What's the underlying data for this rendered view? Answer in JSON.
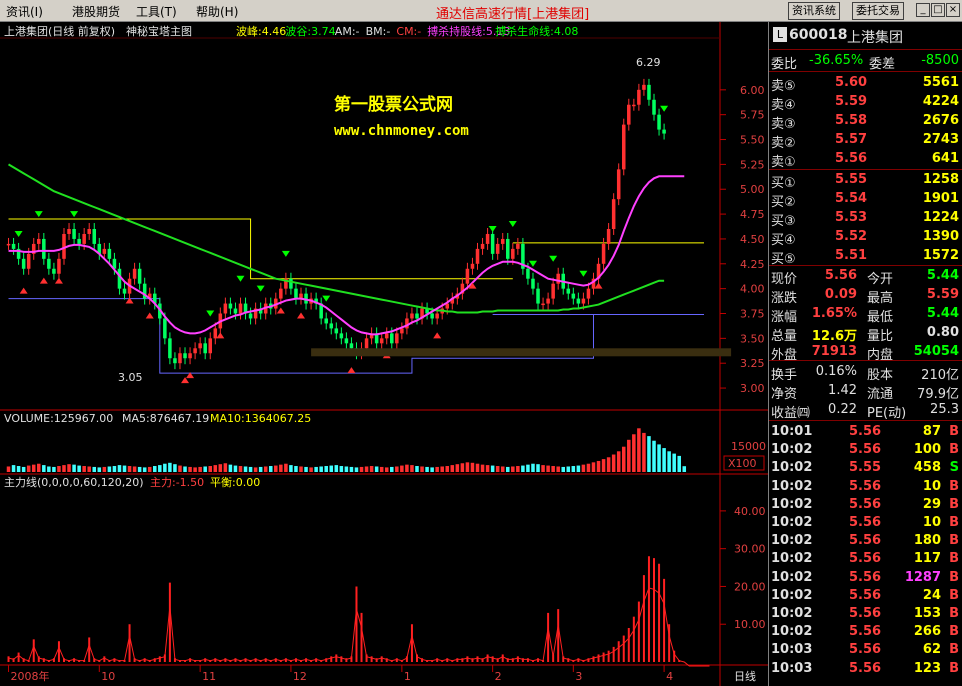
{
  "menu": {
    "items": [
      "资讯(I)",
      "港股期货",
      "工具(T)",
      "帮助(H)"
    ],
    "app_title": "通达信高速行情[上港集团]",
    "buttons": [
      "资讯系统",
      "委托交易"
    ],
    "window_buttons": [
      "_",
      "□",
      "×"
    ]
  },
  "chart_header": {
    "name": "上港集团(日线 前复权)",
    "indicator": "神秘宝塔主图",
    "boxes": [
      {
        "label": "波峰:4.46",
        "color": "#ffff00"
      },
      {
        "label": "波谷:3.74",
        "color": "#00ff00"
      },
      {
        "label": "AM:-",
        "color": "#e0e0e0"
      },
      {
        "label": "BM:-",
        "color": "#e0e0e0"
      },
      {
        "label": "CM:-",
        "color": "#ff4040"
      },
      {
        "label": "搏杀持股线:5.13",
        "color": "#ff40ff"
      },
      {
        "label": "搏杀生命线:4.08",
        "color": "#00ff00"
      }
    ]
  },
  "watermark": {
    "line1": "第一股票公式网",
    "line2": "www.chnmoney.com"
  },
  "annotations": {
    "high": "6.29",
    "low": "3.05"
  },
  "volume_header": {
    "label": "VOLUME:125967.00",
    "ma5": "MA5:876467.19",
    "ma10": "MA10:1364067.25"
  },
  "force_header": {
    "label": "主力线(0,0,0,0,60,120,20)",
    "main": "主力:-1.50",
    "balance": "平衡:0.00"
  },
  "volume_axis": {
    "tick": "15000",
    "unit": "X100"
  },
  "force_axis": {
    "ticks": [
      "40.00",
      "30.00",
      "20.00",
      "10.00"
    ]
  },
  "xaxis": {
    "labels": [
      "2008年",
      "10",
      "11",
      "12",
      "1",
      "2",
      "3",
      "4"
    ],
    "period": "日线"
  },
  "chart_data": {
    "type": "line",
    "title": "上港集团(日线 前复权)",
    "ylim": [
      2.9,
      6.3
    ],
    "yticks": [
      "6.00",
      "5.75",
      "5.50",
      "5.25",
      "5.00",
      "4.75",
      "4.50",
      "4.25",
      "4.00",
      "3.75",
      "3.50",
      "3.25",
      "3.00"
    ],
    "x": [
      1,
      2,
      3,
      4,
      5,
      6,
      7,
      8,
      9,
      10,
      11,
      12,
      13,
      14,
      15,
      16,
      17,
      18,
      19,
      20,
      21,
      22,
      23,
      24,
      25,
      26,
      27,
      28,
      29,
      30,
      31,
      32,
      33,
      34,
      35,
      36,
      37,
      38,
      39,
      40,
      41,
      42,
      43,
      44,
      45,
      46,
      47,
      48,
      49,
      50,
      51,
      52,
      53,
      54,
      55,
      56,
      57,
      58,
      59,
      60,
      61,
      62,
      63,
      64,
      65,
      66,
      67,
      68,
      69,
      70,
      71,
      72,
      73,
      74,
      75,
      76,
      77,
      78,
      79,
      80,
      81,
      82,
      83,
      84,
      85,
      86,
      87,
      88,
      89,
      90,
      91,
      92,
      93,
      94,
      95,
      96,
      97,
      98,
      99,
      100,
      101,
      102,
      103,
      104,
      105,
      106,
      107,
      108,
      109,
      110,
      111,
      112,
      113,
      114,
      115,
      116,
      117,
      118,
      119,
      120,
      121,
      122,
      123,
      124,
      125,
      126,
      127,
      128,
      129,
      130,
      131,
      132,
      133,
      134,
      135,
      136,
      137,
      138,
      139,
      140
    ],
    "series": [
      {
        "name": "close",
        "values": [
          4.45,
          4.4,
          4.3,
          4.2,
          4.35,
          4.45,
          4.5,
          4.3,
          4.2,
          4.15,
          4.3,
          4.55,
          4.6,
          4.5,
          4.45,
          4.55,
          4.6,
          4.45,
          4.35,
          4.4,
          4.3,
          4.2,
          4.0,
          3.95,
          4.1,
          4.2,
          4.05,
          3.9,
          3.95,
          3.85,
          3.7,
          3.5,
          3.3,
          3.25,
          3.35,
          3.3,
          3.35,
          3.4,
          3.45,
          3.35,
          3.5,
          3.6,
          3.75,
          3.85,
          3.8,
          3.75,
          3.85,
          3.75,
          3.7,
          3.8,
          3.75,
          3.85,
          3.8,
          3.9,
          4.0,
          4.1,
          4.0,
          3.9,
          3.95,
          3.85,
          3.9,
          3.85,
          3.7,
          3.65,
          3.6,
          3.55,
          3.5,
          3.45,
          3.4,
          3.35,
          3.4,
          3.5,
          3.55,
          3.45,
          3.5,
          3.55,
          3.45,
          3.55,
          3.6,
          3.7,
          3.75,
          3.7,
          3.8,
          3.75,
          3.7,
          3.75,
          3.8,
          3.85,
          3.9,
          3.95,
          4.05,
          4.2,
          4.25,
          4.4,
          4.45,
          4.55,
          4.35,
          4.45,
          4.5,
          4.3,
          4.4,
          4.45,
          4.2,
          4.1,
          4.0,
          3.85,
          3.85,
          3.9,
          4.05,
          4.15,
          4.0,
          3.95,
          3.9,
          3.85,
          3.9,
          4.0,
          4.1,
          4.25,
          4.45,
          4.6,
          4.9,
          5.2,
          5.65,
          5.85,
          5.85,
          6.0,
          6.05,
          5.9,
          5.75,
          5.6,
          5.56
        ]
      },
      {
        "name": "搏杀持股线",
        "values": [
          4.38,
          4.38,
          4.38,
          4.37,
          4.37,
          4.37,
          4.38,
          4.38,
          4.38,
          4.38,
          4.39,
          4.41,
          4.43,
          4.44,
          4.44,
          4.43,
          4.42,
          4.39,
          4.35,
          4.3,
          4.25,
          4.19,
          4.13,
          4.07,
          4.03,
          4.0,
          3.97,
          3.94,
          3.9,
          3.85,
          3.79,
          3.72,
          3.66,
          3.61,
          3.58,
          3.56,
          3.55,
          3.55,
          3.56,
          3.58,
          3.61,
          3.64,
          3.67,
          3.69,
          3.71,
          3.73,
          3.74,
          3.76,
          3.77,
          3.78,
          3.79,
          3.81,
          3.82,
          3.84,
          3.86,
          3.88,
          3.89,
          3.9,
          3.9,
          3.89,
          3.88,
          3.86,
          3.84,
          3.81,
          3.77,
          3.73,
          3.69,
          3.65,
          3.61,
          3.58,
          3.56,
          3.55,
          3.54,
          3.54,
          3.55,
          3.56,
          3.57,
          3.59,
          3.61,
          3.63,
          3.66,
          3.68,
          3.71,
          3.74,
          3.77,
          3.8,
          3.83,
          3.86,
          3.9,
          3.93,
          3.97,
          4.01,
          4.06,
          4.11,
          4.16,
          4.2,
          4.23,
          4.25,
          4.27,
          4.27,
          4.27,
          4.26,
          4.24,
          4.22,
          4.19,
          4.16,
          4.13,
          4.1,
          4.09,
          4.08,
          4.07,
          4.06,
          4.05,
          4.04,
          4.03,
          4.04,
          4.07,
          4.11,
          4.17,
          4.24,
          4.33,
          4.44,
          4.58,
          4.71,
          4.83,
          4.93,
          5.01,
          5.07,
          5.11,
          5.13,
          5.13,
          5.13,
          5.13,
          5.13,
          5.13
        ]
      },
      {
        "name": "搏杀生命线",
        "values": [
          5.25,
          5.22,
          5.19,
          5.16,
          5.13,
          5.1,
          5.07,
          5.04,
          5.01,
          4.98,
          4.96,
          4.94,
          4.92,
          4.9,
          4.88,
          4.86,
          4.84,
          4.82,
          4.8,
          4.78,
          4.76,
          4.74,
          4.72,
          4.7,
          4.68,
          4.66,
          4.64,
          4.62,
          4.6,
          4.58,
          4.56,
          4.54,
          4.52,
          4.5,
          4.48,
          4.46,
          4.44,
          4.42,
          4.4,
          4.38,
          4.36,
          4.34,
          4.32,
          4.3,
          4.28,
          4.26,
          4.24,
          4.22,
          4.2,
          4.18,
          4.16,
          4.14,
          4.12,
          4.1,
          4.09,
          4.08,
          4.07,
          4.06,
          4.05,
          4.04,
          4.03,
          4.02,
          4.01,
          4.0,
          3.99,
          3.98,
          3.97,
          3.96,
          3.95,
          3.94,
          3.93,
          3.92,
          3.91,
          3.9,
          3.89,
          3.88,
          3.87,
          3.86,
          3.85,
          3.84,
          3.83,
          3.82,
          3.81,
          3.8,
          3.79,
          3.78,
          3.78,
          3.77,
          3.77,
          3.76,
          3.76,
          3.76,
          3.76,
          3.76,
          3.77,
          3.77,
          3.77,
          3.78,
          3.78,
          3.78,
          3.78,
          3.78,
          3.78,
          3.78,
          3.78,
          3.78,
          3.78,
          3.78,
          3.78,
          3.78,
          3.79,
          3.79,
          3.8,
          3.8,
          3.81,
          3.82,
          3.83,
          3.84,
          3.86,
          3.88,
          3.9,
          3.92,
          3.94,
          3.96,
          3.98,
          4.0,
          4.02,
          4.04,
          4.06,
          4.08,
          4.08
        ]
      },
      {
        "name": "volume",
        "values": [
          1200,
          1500,
          1300,
          1100,
          1400,
          1600,
          1800,
          1500,
          1200,
          1100,
          1300,
          1500,
          1700,
          1600,
          1400,
          1300,
          1200,
          1100,
          1000,
          1100,
          1200,
          1300,
          1500,
          1400,
          1300,
          1200,
          1100,
          1000,
          1100,
          1300,
          1500,
          1800,
          2000,
          1700,
          1400,
          1200,
          1100,
          1000,
          1100,
          1200,
          1300,
          1500,
          1700,
          1900,
          1600,
          1400,
          1300,
          1200,
          1100,
          1000,
          1100,
          1200,
          1300,
          1400,
          1600,
          1800,
          1500,
          1300,
          1200,
          1100,
          1000,
          1100,
          1200,
          1300,
          1400,
          1500,
          1300,
          1200,
          1100,
          1000,
          1100,
          1200,
          1300,
          1200,
          1100,
          1000,
          1100,
          1200,
          1400,
          1600,
          1500,
          1300,
          1200,
          1100,
          1000,
          1100,
          1200,
          1300,
          1500,
          1700,
          1900,
          2100,
          2000,
          1800,
          1600,
          1500,
          1400,
          1300,
          1200,
          1100,
          1200,
          1300,
          1400,
          1600,
          1800,
          1700,
          1500,
          1400,
          1300,
          1200,
          1100,
          1200,
          1300,
          1400,
          1600,
          1800,
          2100,
          2400,
          2800,
          3200,
          3800,
          4500,
          5500,
          7000,
          8200,
          9500,
          8500,
          7800,
          6800,
          6000,
          5200,
          4500,
          4000,
          3500,
          1260
        ]
      },
      {
        "name": "主力",
        "values": [
          1.5,
          1.0,
          2.5,
          1.0,
          0.5,
          6.0,
          1.5,
          1.0,
          0.5,
          1.0,
          5.5,
          1.0,
          0.5,
          1.0,
          0.5,
          0.5,
          6.5,
          1.0,
          0.5,
          1.5,
          0.5,
          1.0,
          0.5,
          0.5,
          10.0,
          1.0,
          0.5,
          1.0,
          0.5,
          1.0,
          1.5,
          2.0,
          21.0,
          1.0,
          0.5,
          0.5,
          1.0,
          0.5,
          0.5,
          1.0,
          0.5,
          1.0,
          0.5,
          1.0,
          0.5,
          1.0,
          0.5,
          1.0,
          0.5,
          1.0,
          0.5,
          1.0,
          0.5,
          1.0,
          0.5,
          1.0,
          0.5,
          1.0,
          0.5,
          1.0,
          0.5,
          1.0,
          0.5,
          1.0,
          1.5,
          2.0,
          1.5,
          1.0,
          1.5,
          20.0,
          13.0,
          2.0,
          1.5,
          1.0,
          1.5,
          1.0,
          0.5,
          1.0,
          0.5,
          1.5,
          10.0,
          2.0,
          1.0,
          0.5,
          0.5,
          1.0,
          0.5,
          1.0,
          0.5,
          1.0,
          1.0,
          1.5,
          1.0,
          1.5,
          1.0,
          2.0,
          1.5,
          1.0,
          2.0,
          1.0,
          1.0,
          1.5,
          1.0,
          1.0,
          0.5,
          1.0,
          0.5,
          13.0,
          2.0,
          14.0,
          1.5,
          1.0,
          0.5,
          1.0,
          0.5,
          1.0,
          1.5,
          2.0,
          2.5,
          3.0,
          4.0,
          5.5,
          7.0,
          9.0,
          12.0,
          16.0,
          23.0,
          28.0,
          27.5,
          26.0,
          22.0,
          10.0,
          3.0,
          0.5,
          0.0,
          -1.5,
          -1.5,
          -1.5,
          -1.5,
          -1.5
        ]
      }
    ],
    "levels": {
      "wave_peak": 4.46,
      "wave_trough": 3.74
    }
  },
  "quote": {
    "code": "600018",
    "name": "上港集团",
    "wei_bi": {
      "label": "委比",
      "value": "-36.65%",
      "diff_label": "委差",
      "diff": "-8500"
    },
    "asks": [
      {
        "label": "卖⑤",
        "price": "5.60",
        "vol": "5561"
      },
      {
        "label": "卖④",
        "price": "5.59",
        "vol": "4224"
      },
      {
        "label": "卖③",
        "price": "5.58",
        "vol": "2676"
      },
      {
        "label": "卖②",
        "price": "5.57",
        "vol": "2743"
      },
      {
        "label": "卖①",
        "price": "5.56",
        "vol": "641"
      }
    ],
    "bids": [
      {
        "label": "买①",
        "price": "5.55",
        "vol": "1258"
      },
      {
        "label": "买②",
        "price": "5.54",
        "vol": "1901"
      },
      {
        "label": "买③",
        "price": "5.53",
        "vol": "1224"
      },
      {
        "label": "买④",
        "price": "5.52",
        "vol": "1390"
      },
      {
        "label": "买⑤",
        "price": "5.51",
        "vol": "1572"
      }
    ],
    "stats": [
      {
        "l1": "现价",
        "v1": "5.56",
        "l2": "今开",
        "v2": "5.44"
      },
      {
        "l1": "涨跌",
        "v1": "0.09",
        "l2": "最高",
        "v2": "5.59"
      },
      {
        "l1": "涨幅",
        "v1": "1.65%",
        "l2": "最低",
        "v2": "5.44"
      },
      {
        "l1": "总量",
        "v1": "12.6万",
        "l2": "量比",
        "v2": "0.80"
      },
      {
        "l1": "外盘",
        "v1": "71913",
        "l2": "内盘",
        "v2": "54054"
      }
    ],
    "stats2": [
      {
        "l1": "换手",
        "v1": "0.16%",
        "l2": "股本",
        "v2": "210亿"
      },
      {
        "l1": "净资",
        "v1": "1.42",
        "l2": "流通",
        "v2": "79.9亿"
      },
      {
        "l1": "收益㈣",
        "v1": "0.22",
        "l2": "PE(动)",
        "v2": "25.3"
      }
    ],
    "ticks": [
      {
        "time": "10:01",
        "price": "5.56",
        "vol": "87",
        "side": "B"
      },
      {
        "time": "10:02",
        "price": "5.56",
        "vol": "100",
        "side": "B"
      },
      {
        "time": "10:02",
        "price": "5.55",
        "vol": "458",
        "side": "S"
      },
      {
        "time": "10:02",
        "price": "5.56",
        "vol": "10",
        "side": "B"
      },
      {
        "time": "10:02",
        "price": "5.56",
        "vol": "29",
        "side": "B"
      },
      {
        "time": "10:02",
        "price": "5.56",
        "vol": "10",
        "side": "B"
      },
      {
        "time": "10:02",
        "price": "5.56",
        "vol": "180",
        "side": "B"
      },
      {
        "time": "10:02",
        "price": "5.56",
        "vol": "117",
        "side": "B"
      },
      {
        "time": "10:02",
        "price": "5.56",
        "vol": "1287",
        "side": "B"
      },
      {
        "time": "10:02",
        "price": "5.56",
        "vol": "24",
        "side": "B"
      },
      {
        "time": "10:02",
        "price": "5.56",
        "vol": "153",
        "side": "B"
      },
      {
        "time": "10:02",
        "price": "5.56",
        "vol": "266",
        "side": "B"
      },
      {
        "time": "10:03",
        "price": "5.56",
        "vol": "62",
        "side": "B"
      },
      {
        "time": "10:03",
        "price": "5.56",
        "vol": "123",
        "side": "B"
      }
    ]
  },
  "colors": {
    "up": "#ff3030",
    "down": "#00ff60",
    "ma1": "#ff40ff",
    "ma2": "#20e020",
    "peak": "#ffff00",
    "trough": "#6666ff",
    "axis": "#c00000"
  }
}
